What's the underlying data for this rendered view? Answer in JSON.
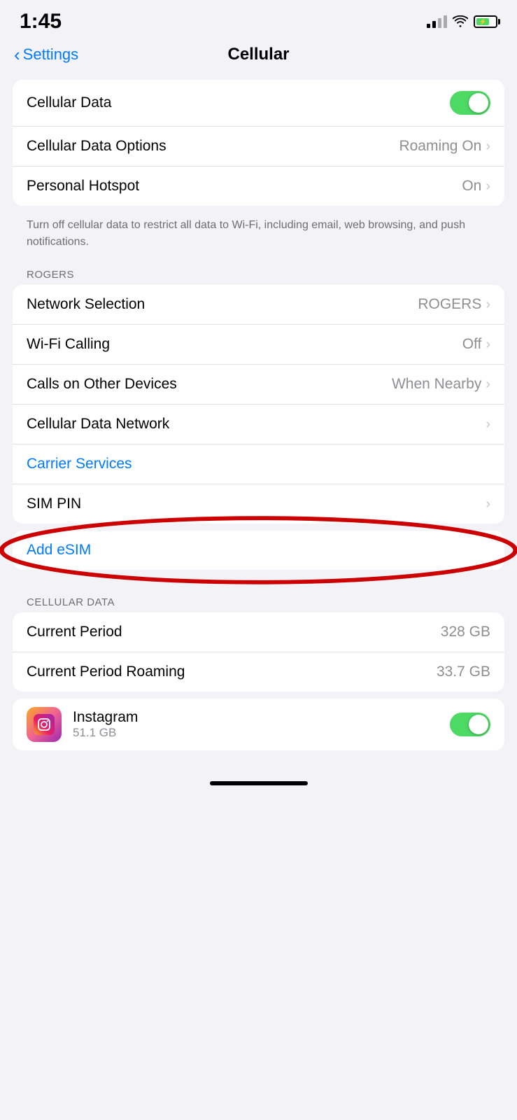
{
  "statusBar": {
    "time": "1:45",
    "signal": [
      4,
      3,
      2,
      1
    ],
    "battery": "70"
  },
  "nav": {
    "backLabel": "Settings",
    "title": "Cellular"
  },
  "topSection": {
    "rows": [
      {
        "label": "Cellular Data",
        "type": "toggle",
        "value": true
      },
      {
        "label": "Cellular Data Options",
        "value": "Roaming On",
        "hasChevron": true
      },
      {
        "label": "Personal Hotspot",
        "value": "On",
        "hasChevron": true
      }
    ],
    "footerNote": "Turn off cellular data to restrict all data to Wi-Fi, including email, web browsing, and push notifications."
  },
  "rogersSectionLabel": "ROGERS",
  "rogersSection": {
    "rows": [
      {
        "label": "Network Selection",
        "value": "ROGERS",
        "hasChevron": true
      },
      {
        "label": "Wi-Fi Calling",
        "value": "Off",
        "hasChevron": true
      },
      {
        "label": "Calls on Other Devices",
        "value": "When Nearby",
        "hasChevron": true
      },
      {
        "label": "Cellular Data Network",
        "value": "",
        "hasChevron": true
      },
      {
        "label": "Carrier Services",
        "value": "",
        "hasChevron": false,
        "isBlue": true
      },
      {
        "label": "SIM PIN",
        "value": "",
        "hasChevron": true
      }
    ]
  },
  "esimSection": {
    "label": "Add eSIM",
    "isBlue": true
  },
  "cellularDataLabel": "CELLULAR DATA",
  "cellularDataSection": {
    "rows": [
      {
        "label": "Current Period",
        "value": "328 GB"
      },
      {
        "label": "Current Period Roaming",
        "value": "33.7 GB"
      }
    ]
  },
  "appSection": {
    "appName": "Instagram",
    "appSize": "51.1 GB",
    "toggle": true
  }
}
